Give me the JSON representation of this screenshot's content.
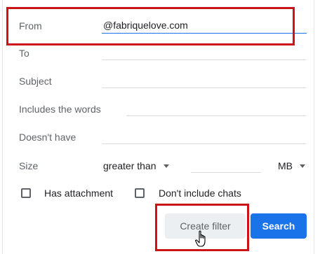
{
  "filter_form": {
    "from": {
      "label": "From",
      "value": "@fabriquelove.com"
    },
    "to": {
      "label": "To",
      "value": ""
    },
    "subject": {
      "label": "Subject",
      "value": ""
    },
    "includes_words": {
      "label": "Includes the words",
      "value": ""
    },
    "doesnt_have": {
      "label": "Doesn't have",
      "value": ""
    },
    "size": {
      "label": "Size",
      "comparator": "greater than",
      "value": "",
      "unit": "MB"
    },
    "has_attachment": {
      "label": "Has attachment",
      "checked": false
    },
    "dont_include_chats": {
      "label": "Don't include chats",
      "checked": false
    }
  },
  "actions": {
    "create_filter_label": "Create filter",
    "search_label": "Search"
  },
  "colors": {
    "accent": "#1a73e8",
    "highlight": "#cc1418"
  }
}
